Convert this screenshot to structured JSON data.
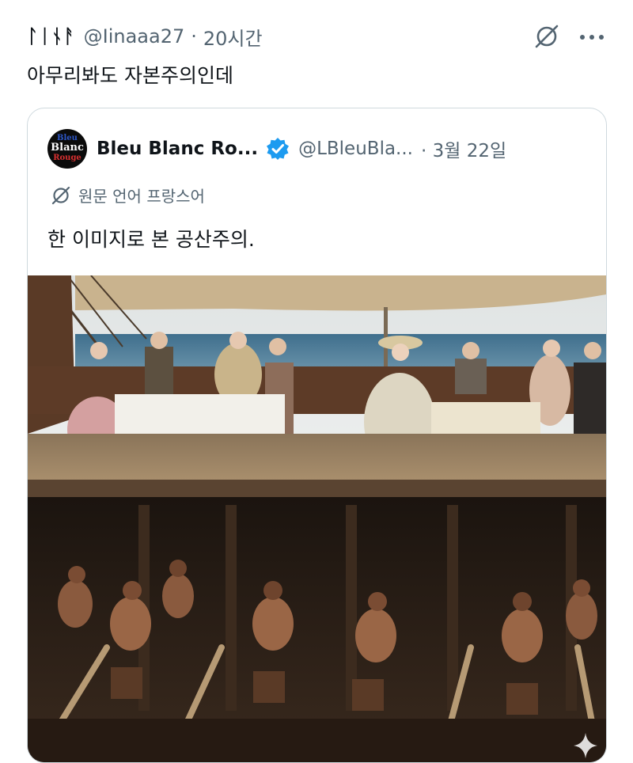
{
  "tweet": {
    "author_name": "ᛚᛁᚾᚨ",
    "handle": "@Iinaaa27",
    "separator": "·",
    "time": "20시간",
    "text": "아무리봐도 자본주의인데",
    "icons": {
      "translate": "translate-icon",
      "more": "more-options-icon"
    }
  },
  "quote": {
    "avatar_lines": [
      "Bleu",
      "Blanc",
      "Rouge"
    ],
    "name": "Bleu Blanc Ro...",
    "handle": "@LBleuBla...",
    "date": "· 3월 22일",
    "source_language_label": "원문 언어 프랑스어",
    "text": "한 이미지로 본 공산주의.",
    "icons": {
      "verified": "verified-badge-icon",
      "translate": "translate-icon",
      "sparkle": "sparkle-icon"
    }
  },
  "colors": {
    "text": "#0f1419",
    "secondary": "#536471",
    "border": "#cfd9de",
    "verified": "#1d9bf0"
  }
}
